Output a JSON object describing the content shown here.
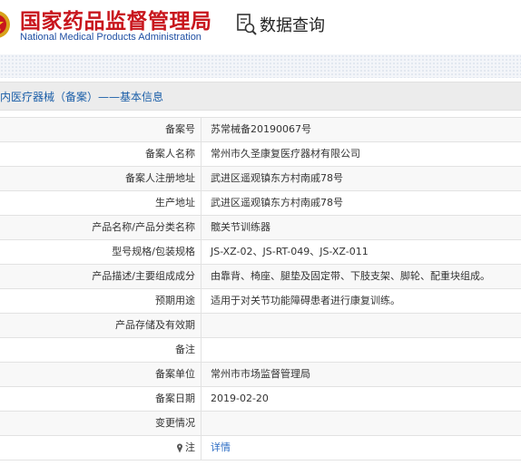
{
  "header": {
    "brand_cn": "国家药品监督管理局",
    "brand_en": "National Medical Products Administration",
    "query_label": "数据查询",
    "query_icon": "document-search-icon",
    "emblem_icon": "national-emblem-icon"
  },
  "colors": {
    "brand_red": "#c8161d",
    "brand_blue": "#1f4fa3",
    "section_title": "#1a5ea8",
    "link": "#2b6cc4"
  },
  "section": {
    "title": "内医疗器械（备案）——基本信息"
  },
  "rows": [
    {
      "label": "备案号",
      "value": "苏常械备20190067号"
    },
    {
      "label": "备案人名称",
      "value": "常州市久圣康复医疗器材有限公司"
    },
    {
      "label": "备案人注册地址",
      "value": "武进区遥观镇东方村南戚78号"
    },
    {
      "label": "生产地址",
      "value": "武进区遥观镇东方村南戚78号"
    },
    {
      "label": "产品名称/产品分类名称",
      "value": "髋关节训练器"
    },
    {
      "label": "型号规格/包装规格",
      "value": "JS-XZ-02、JS-RT-049、JS-XZ-011"
    },
    {
      "label": "产品描述/主要组成成分",
      "value": "由靠背、椅座、腿垫及固定带、下肢支架、脚轮、配重块组成。"
    },
    {
      "label": "预期用途",
      "value": "适用于对关节功能障碍患者进行康复训练。"
    },
    {
      "label": "产品存储及有效期",
      "value": ""
    },
    {
      "label": "备注",
      "value": ""
    },
    {
      "label": "备案单位",
      "value": "常州市市场监督管理局"
    },
    {
      "label": "备案日期",
      "value": "2019-02-20"
    },
    {
      "label": "变更情况",
      "value": ""
    },
    {
      "label": "注",
      "value": "详情",
      "label_icon": "pin-icon"
    }
  ]
}
